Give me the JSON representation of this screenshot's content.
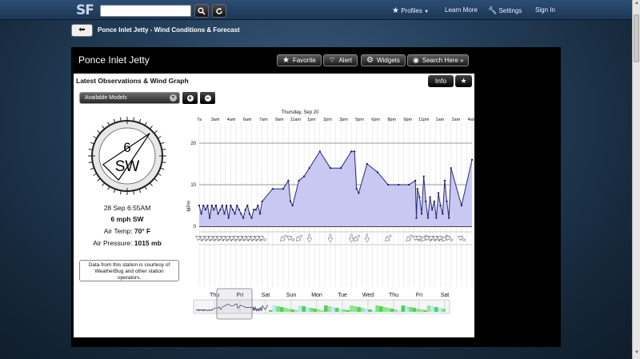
{
  "brand": {
    "logo": "SF"
  },
  "nav": {
    "profiles": "Profiles",
    "learn_more": "Learn More",
    "settings": "Settings",
    "sign_in": "Sign In"
  },
  "page": {
    "breadcrumb": "Ponce Inlet Jetty - Wind Conditions & Forecast",
    "spot_name": "Ponce Inlet Jetty"
  },
  "actions": {
    "favorite": "Favorite",
    "alert": "Alert",
    "widgets": "Widgets",
    "search_here": "Search Here »"
  },
  "card": {
    "title": "Latest Observations & Wind Graph",
    "info_label": "Info",
    "models_label": "Available Models"
  },
  "compass": {
    "speed": "6",
    "direction": "SW",
    "heading_deg": 225
  },
  "observation": {
    "time": "28 Sep 6:55AM",
    "wind": "6 mph SW",
    "air_temp_label": "Air Temp:",
    "air_temp_value": "70° F",
    "pressure_label": "Air Pressure:",
    "pressure_value": "1015 mb",
    "courtesy": "Data from this station is courtesy of WeatherBug and other station operators."
  },
  "chart_data": {
    "type": "area",
    "title": "Thursday, Sep 20",
    "ylabel": "MPH",
    "ylim": [
      0,
      25
    ],
    "y_ticks": [
      0,
      10,
      20
    ],
    "x_tick_labels": [
      "7a",
      "3am",
      "4am",
      "6am",
      "7am",
      "9am",
      "11am",
      "1pm",
      "2pm",
      "3pm",
      "5pm",
      "6pm",
      "8pm",
      "9pm",
      "11pm",
      "1am",
      "2am",
      "4am"
    ],
    "x_range_hours": [
      2,
      28
    ],
    "series": [
      {
        "x": [
          2.0,
          2.2,
          2.4,
          2.6,
          2.8,
          3.0,
          3.2,
          3.4,
          3.6,
          3.8,
          4.0,
          4.2,
          4.4,
          4.6,
          4.8,
          5.0,
          5.2,
          5.4,
          5.6,
          5.8,
          6.0,
          6.2,
          6.4,
          6.6,
          6.8,
          7.0,
          7.2,
          7.4,
          7.6,
          7.8,
          8.0,
          9.0,
          10.0,
          10.5,
          10.7,
          10.9,
          11.5,
          12.0,
          12.5,
          13.5,
          14.5,
          15.5,
          16.5,
          16.8,
          17.0,
          17.2,
          18.0,
          19.0,
          20.0,
          21.0,
          22.0,
          22.6,
          22.7,
          22.8,
          23.0,
          23.2,
          23.4,
          23.6,
          23.8,
          24.0,
          24.2,
          24.4,
          24.6,
          24.8,
          25.0,
          25.2,
          25.4,
          25.6,
          25.8,
          26.0,
          27.0,
          28.0
        ],
        "y": [
          5,
          3,
          5,
          4,
          5,
          2,
          5,
          4,
          5,
          3,
          4,
          5,
          3,
          5,
          2,
          5,
          4,
          3,
          5,
          4,
          3,
          2,
          4,
          5,
          3,
          2,
          4,
          4,
          5,
          3,
          6,
          9,
          9,
          11,
          6,
          5,
          11,
          12,
          14,
          18,
          14,
          14,
          18,
          18,
          9,
          8,
          15,
          13,
          10,
          10,
          10,
          11,
          2,
          9,
          7,
          3,
          12,
          6,
          2,
          7,
          4,
          6,
          2,
          8,
          5,
          3,
          11,
          6,
          2,
          14,
          5,
          16
        ]
      }
    ],
    "navigator_days": [
      "Thu",
      "Fri",
      "Sat",
      "Sun",
      "Mon",
      "Tue",
      "Wed",
      "Thu",
      "Fri",
      "Sat"
    ]
  }
}
